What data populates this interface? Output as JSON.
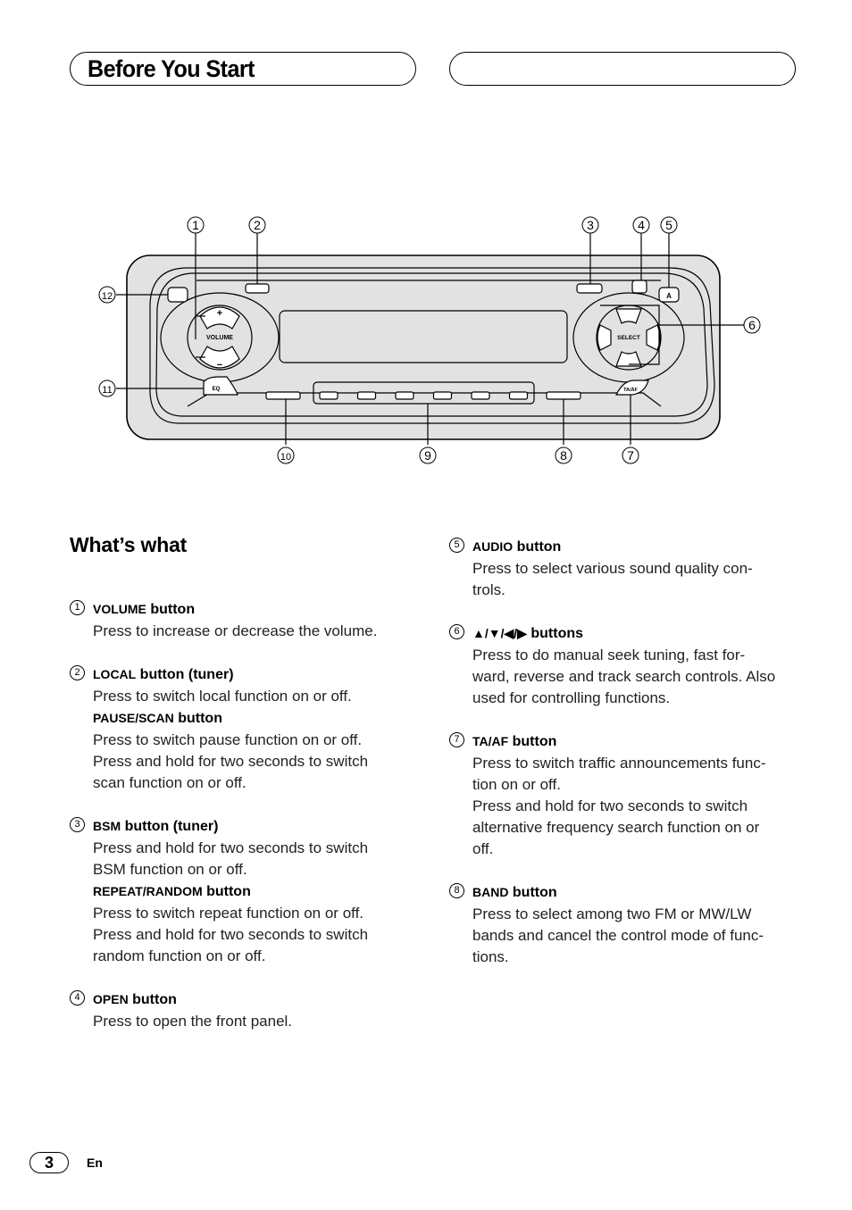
{
  "header": {
    "title": "Before You Start",
    "right_pill_text": ""
  },
  "diagram": {
    "labels": {
      "volume": "VOLUME",
      "select": "SELECT",
      "eq": "EQ",
      "ta_af": "TA/ÄF",
      "audio": "A",
      "plus": "+",
      "minus": "−"
    },
    "callouts": [
      "1",
      "2",
      "3",
      "4",
      "5",
      "6",
      "7",
      "8",
      "9",
      "10",
      "11",
      "12"
    ],
    "preset_button_count": 6
  },
  "section": {
    "title": "What’s what"
  },
  "entries_left": [
    {
      "num": "1",
      "items": [
        {
          "title_caps": "VOLUME",
          "title_rest": " button",
          "desc": "Press to increase or decrease the volume."
        }
      ]
    },
    {
      "num": "2",
      "items": [
        {
          "title_caps": "LOCAL",
          "title_rest": " button (tuner)",
          "desc": "Press to switch local function on or off."
        },
        {
          "title_caps": "PAUSE/SCAN",
          "title_rest": " button",
          "desc": "Press to switch pause function on or off.\nPress and hold for two seconds to switch\nscan function on or off."
        }
      ]
    },
    {
      "num": "3",
      "items": [
        {
          "title_caps": "BSM",
          "title_rest": " button (tuner)",
          "desc": "Press and hold for two seconds to switch\nBSM function on or off."
        },
        {
          "title_caps": "REPEAT/RANDOM",
          "title_rest": " button",
          "desc": "Press to switch repeat function on or off.\nPress and hold for two seconds to switch\nrandom function on or off."
        }
      ]
    },
    {
      "num": "4",
      "items": [
        {
          "title_caps": "OPEN",
          "title_rest": " button",
          "desc": "Press to open the front panel."
        }
      ]
    }
  ],
  "entries_right": [
    {
      "num": "5",
      "items": [
        {
          "title_caps": "AUDIO",
          "title_rest": " button",
          "desc": "Press to select various sound quality con-\ntrols."
        }
      ]
    },
    {
      "num": "6",
      "items": [
        {
          "title_caps": "▲/▼/◀/▶",
          "title_rest": " buttons",
          "desc": "Press to do manual seek tuning, fast for-\nward, reverse and track search controls. Also\nused for controlling functions."
        }
      ]
    },
    {
      "num": "7",
      "items": [
        {
          "title_caps": "TA/AF",
          "title_rest": " button",
          "desc": "Press to switch traffic announcements func-\ntion on or off.\nPress and hold for two seconds to switch\nalternative frequency search function on or\noff."
        }
      ]
    },
    {
      "num": "8",
      "items": [
        {
          "title_caps": "BAND",
          "title_rest": " button",
          "desc": "Press to select among two FM or MW/LW\nbands and cancel the control mode of func-\ntions."
        }
      ]
    }
  ],
  "footer": {
    "page_number": "3",
    "language": "En"
  }
}
